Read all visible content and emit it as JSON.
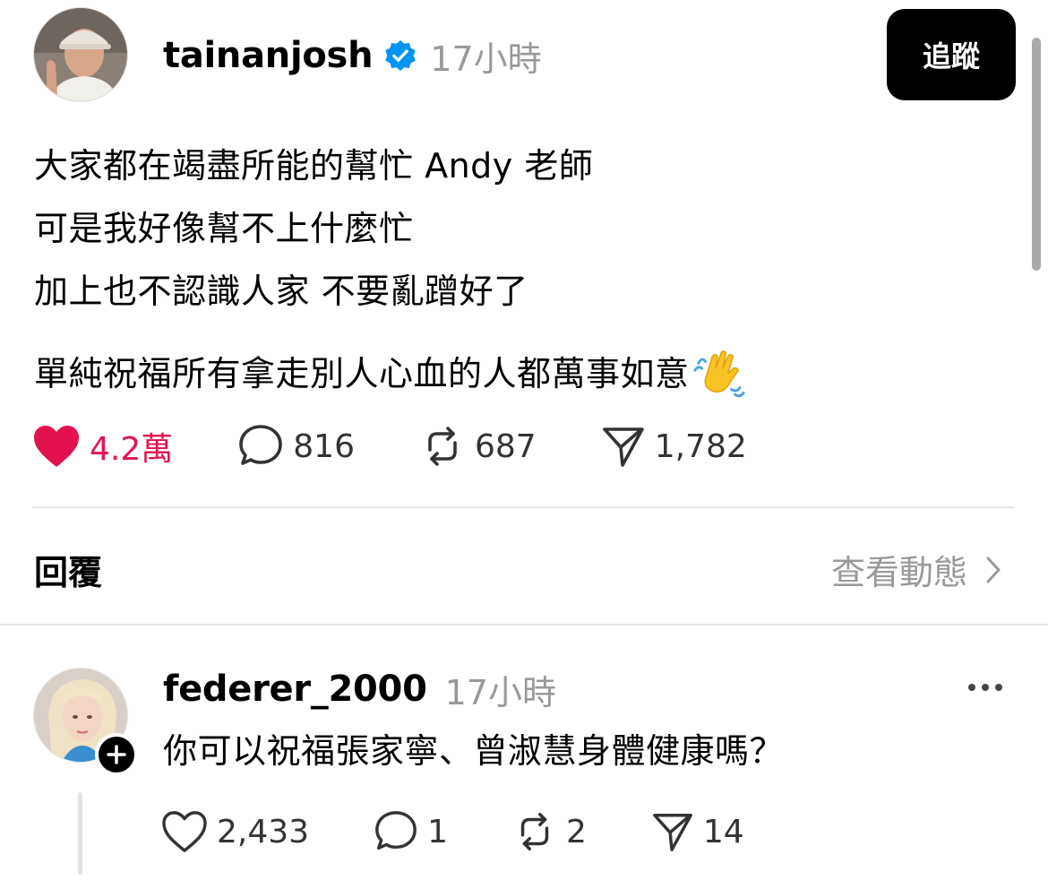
{
  "post": {
    "username": "tainanjosh",
    "timestamp": "17小時",
    "follow_label": "追蹤",
    "text_lines": [
      "大家都在竭盡所能的幫忙 Andy 老師",
      "可是我好像幫不上什麼忙",
      "加上也不認識人家 不要亂蹭好了"
    ],
    "text_para2": "單純祝福所有拿走別人心血的人都萬事如意",
    "emoji": "waving-hand",
    "likes": "4.2萬",
    "comments": "816",
    "reposts": "687",
    "shares": "1,782",
    "liked": true
  },
  "replies_section": {
    "title": "回覆",
    "activity_label": "查看動態"
  },
  "reply": {
    "username": "federer_2000",
    "timestamp": "17小時",
    "text": "你可以祝福張家寧、曾淑慧身體健康嗎？",
    "likes": "2,433",
    "comments": "1",
    "reposts": "2",
    "shares": "14"
  },
  "colors": {
    "like_red": "#e3124e",
    "verified_blue": "#0095f6",
    "muted_gray": "#999999"
  }
}
